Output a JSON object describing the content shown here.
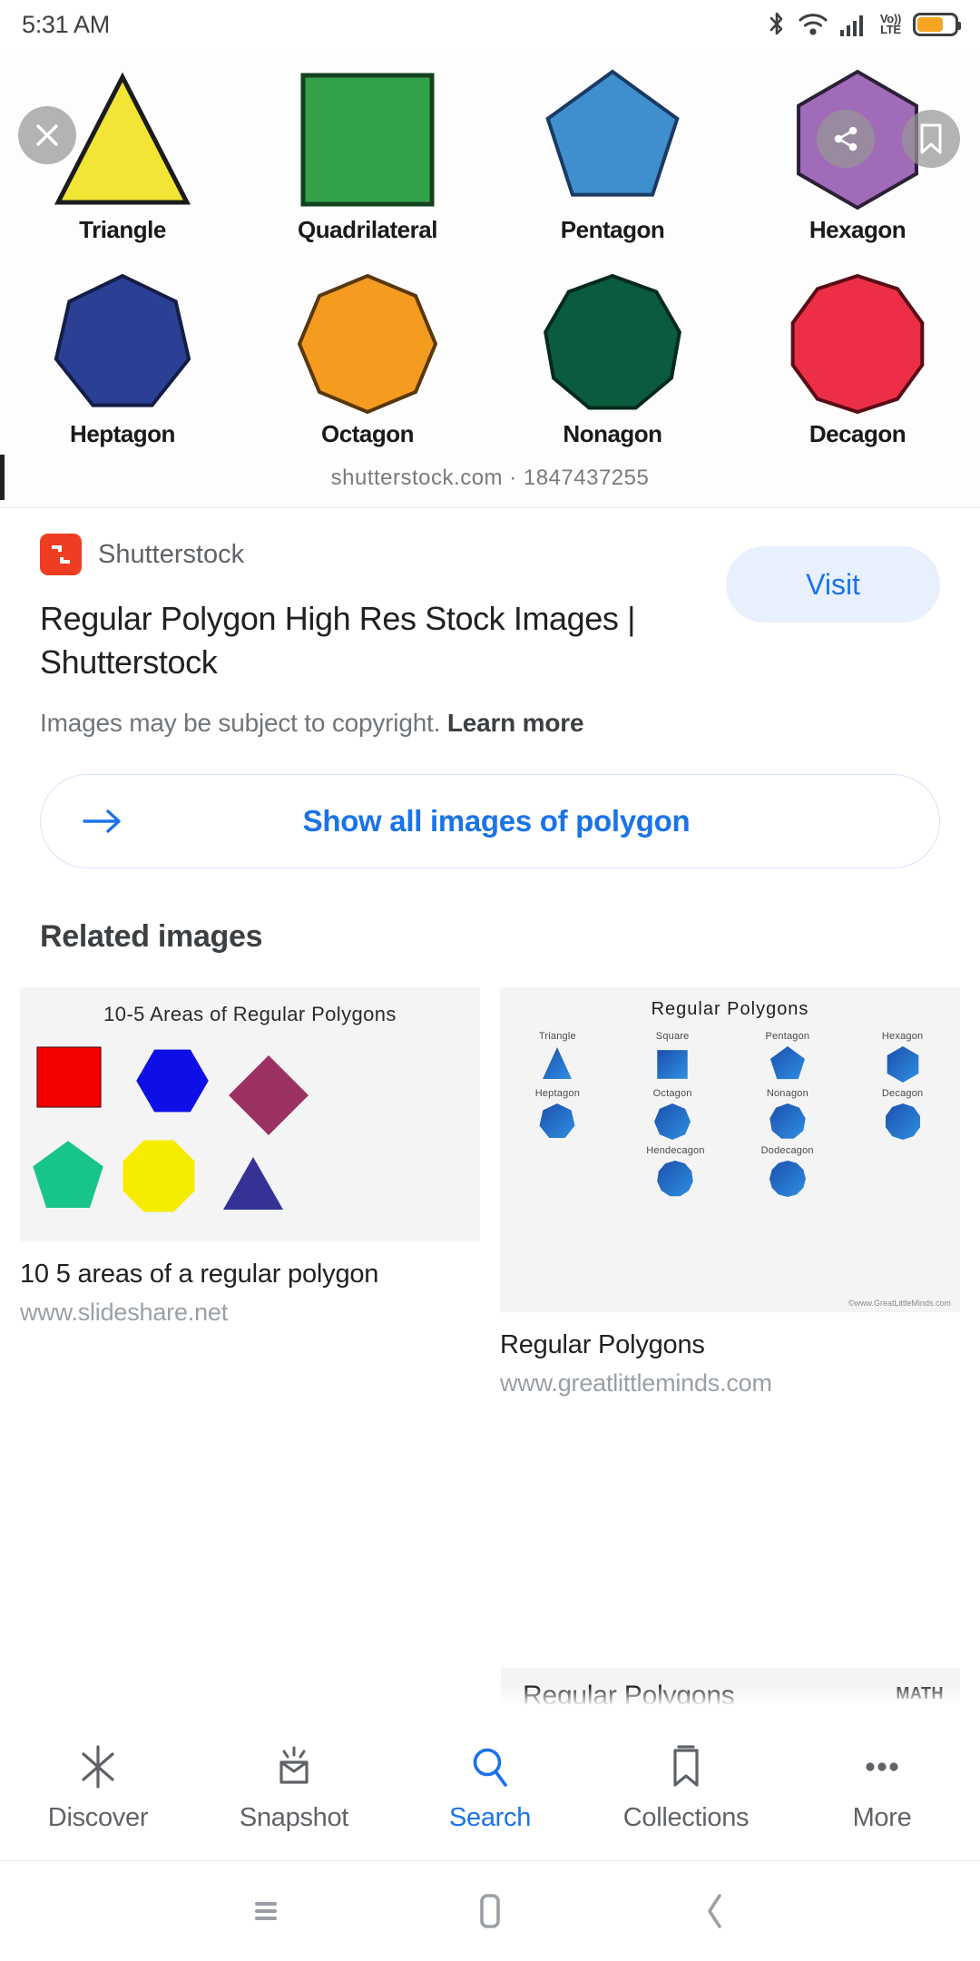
{
  "status_bar": {
    "time": "5:31 AM",
    "icons": [
      "bluetooth-icon",
      "wifi-icon",
      "cellular-signal-icon",
      "volte-icon",
      "battery-icon"
    ],
    "volte_top": "Vo))",
    "volte_bottom": "LTE",
    "battery_color": "#f5a623",
    "battery_level": 70
  },
  "viewer": {
    "overlay_buttons": [
      {
        "name": "close-icon",
        "label": "Close"
      },
      {
        "name": "share-icon",
        "label": "Share"
      },
      {
        "name": "bookmark-icon",
        "label": "Save"
      }
    ],
    "watermark": "shutterstock.com · 1847437255",
    "shapes": [
      {
        "label": "Triangle",
        "sides": 3,
        "fill": "#f2e535",
        "stroke": "#1b1b1b"
      },
      {
        "label": "Quadrilateral",
        "sides": 4,
        "fill": "#34a24a",
        "stroke": "#14421f"
      },
      {
        "label": "Pentagon",
        "sides": 5,
        "fill": "#3f8fce",
        "stroke": "#1a3a63"
      },
      {
        "label": "Hexagon",
        "sides": 6,
        "fill": "#a06bb8",
        "stroke": "#2c2036"
      },
      {
        "label": "Heptagon",
        "sides": 7,
        "fill": "#2b3f95",
        "stroke": "#141d46"
      },
      {
        "label": "Octagon",
        "sides": 8,
        "fill": "#f59b1f",
        "stroke": "#58380b"
      },
      {
        "label": "Nonagon",
        "sides": 9,
        "fill": "#0b5c3e",
        "stroke": "#042a1c"
      },
      {
        "label": "Decagon",
        "sides": 10,
        "fill": "#ec2f47",
        "stroke": "#5a0d17"
      }
    ]
  },
  "result_card": {
    "source_name": "Shutterstock",
    "source_logo_color": "#ee3d23",
    "title": "Regular Polygon High Res Stock Images | Shutterstock",
    "copyright_text": "Images may be subject to copyright.",
    "copyright_link": "Learn more",
    "visit_label": "Visit"
  },
  "show_all": {
    "label": "Show all images of polygon",
    "icon": "arrow-right-icon",
    "accent": "#1a73e8"
  },
  "related": {
    "heading": "Related images",
    "items": [
      {
        "title": "10 5 areas of a regular polygon",
        "url": "www.slideshare.net",
        "thumb_title": "10-5 Areas of Regular Polygons",
        "thumb_shapes": [
          {
            "name": "square",
            "fill": "#f40000"
          },
          {
            "name": "hexagon",
            "fill": "#0e0ee6"
          },
          {
            "name": "diamond",
            "fill": "#9c3163"
          },
          {
            "name": "pentagon",
            "fill": "#16c48c"
          },
          {
            "name": "octagon",
            "fill": "#f6ec00"
          },
          {
            "name": "triangle",
            "fill": "#343395"
          }
        ]
      },
      {
        "title": "Regular Polygons",
        "url": "www.greatlittleminds.com",
        "thumb_title": "Regular Polygons",
        "thumb_credit": "©www.GreatLittleMinds.com",
        "thumb_shapes": [
          {
            "label": "Triangle",
            "sides": 3
          },
          {
            "label": "Square",
            "sides": 4
          },
          {
            "label": "Pentagon",
            "sides": 5
          },
          {
            "label": "Hexagon",
            "sides": 6
          },
          {
            "label": "Heptagon",
            "sides": 7
          },
          {
            "label": "Octagon",
            "sides": 8
          },
          {
            "label": "Nonagon",
            "sides": 9
          },
          {
            "label": "Decagon",
            "sides": 10
          },
          {
            "label": "Hendecagon",
            "sides": 11
          },
          {
            "label": "Dodecagon",
            "sides": 12
          }
        ]
      }
    ],
    "partial_card": {
      "title": "Regular Polygons",
      "badge": "MATH"
    }
  },
  "bottom_nav": {
    "items": [
      {
        "label": "Discover",
        "icon": "asterisk-icon",
        "active": false
      },
      {
        "label": "Snapshot",
        "icon": "snapshot-icon",
        "active": false
      },
      {
        "label": "Search",
        "icon": "search-icon",
        "active": true
      },
      {
        "label": "Collections",
        "icon": "bookmark-icon",
        "active": false
      },
      {
        "label": "More",
        "icon": "more-dots-icon",
        "active": false
      }
    ],
    "active_color": "#1a73e8",
    "inactive_color": "#5f6368"
  },
  "system_nav": {
    "buttons": [
      {
        "name": "recents-icon",
        "label": "Recents"
      },
      {
        "name": "home-icon",
        "label": "Home"
      },
      {
        "name": "back-icon",
        "label": "Back"
      }
    ]
  }
}
